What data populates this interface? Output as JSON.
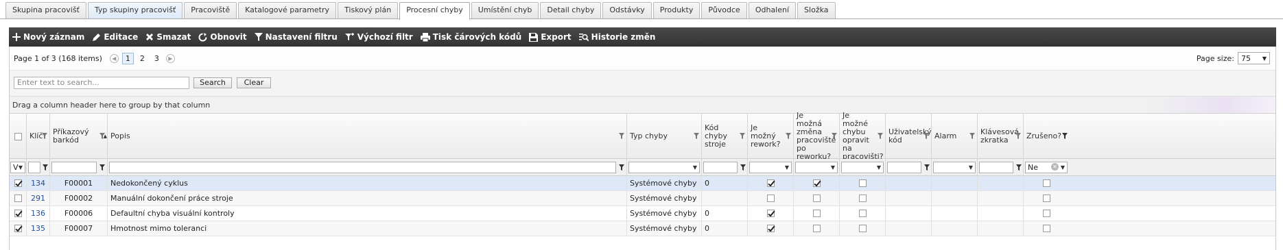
{
  "tabs": [
    {
      "label": "Skupina pracovišť",
      "state": "normal"
    },
    {
      "label": "Typ skupiny pracovišť",
      "state": "hover"
    },
    {
      "label": "Pracoviště",
      "state": "normal"
    },
    {
      "label": "Katalogové parametry",
      "state": "normal"
    },
    {
      "label": "Tiskový plán",
      "state": "normal"
    },
    {
      "label": "Procesní chyby",
      "state": "selected"
    },
    {
      "label": "Umístění chyb",
      "state": "normal"
    },
    {
      "label": "Detail chyby",
      "state": "normal"
    },
    {
      "label": "Odstávky",
      "state": "normal"
    },
    {
      "label": "Produkty",
      "state": "normal"
    },
    {
      "label": "Původce",
      "state": "normal"
    },
    {
      "label": "Odhalení",
      "state": "normal"
    },
    {
      "label": "Složka",
      "state": "normal"
    }
  ],
  "toolbar": {
    "new": "Nový záznam",
    "edit": "Editace",
    "delete": "Smazat",
    "refresh": "Obnovit",
    "filter_settings": "Nastavení filtru",
    "default_filter": "Výchozí filtr",
    "print_barcodes": "Tisk čárových kódů",
    "export": "Export",
    "history": "Historie změn"
  },
  "pager": {
    "info": "Page 1 of 3 (168 items)",
    "pages": [
      "1",
      "2",
      "3"
    ],
    "current_page": "1",
    "page_size_label": "Page size:",
    "page_size": "75"
  },
  "search": {
    "placeholder": "Enter text to search...",
    "search_button": "Search",
    "clear_button": "Clear"
  },
  "group_panel_text": "Drag a column header here to group by that column",
  "columns": {
    "key": "Klíč",
    "barcode": "Příkazový barkód",
    "description": "Popis",
    "error_type": "Typ chyby",
    "machine_code": "Kód chyby stroje",
    "rework": "Je možný rework?",
    "change_ws": "Je možná změna pracoviště po reworku?",
    "fix_ws": "Je možné chybu opravit na pracovišti?",
    "user_code": "Uživatelský kód",
    "alarm": "Alarm",
    "shortcut": "Klávesová zkratka",
    "cancelled": "Zrušeno?"
  },
  "filters": {
    "select_value": "V",
    "cancelled_value": "Ne"
  },
  "rows": [
    {
      "checked": true,
      "key": "134",
      "barcode": "F00001",
      "description": "Nedokončený cyklus",
      "error_type": "Systémové chyby",
      "machine_code": "0",
      "rework": true,
      "change_ws": true,
      "fix_ws": false,
      "cancelled": false
    },
    {
      "checked": false,
      "key": "291",
      "barcode": "F00002",
      "description": "Manuální dokončení práce stroje",
      "error_type": "Systémové chyby",
      "machine_code": "",
      "rework": false,
      "change_ws": false,
      "fix_ws": false,
      "cancelled": false
    },
    {
      "checked": true,
      "key": "136",
      "barcode": "F00006",
      "description": "Defaultní chyba visuální kontroly",
      "error_type": "Systémové chyby",
      "machine_code": "0",
      "rework": true,
      "change_ws": false,
      "fix_ws": false,
      "cancelled": false
    },
    {
      "checked": true,
      "key": "135",
      "barcode": "F00007",
      "description": "Hmotnost mimo toleranci",
      "error_type": "Systémové chyby",
      "machine_code": "0",
      "rework": true,
      "change_ws": false,
      "fix_ws": false,
      "cancelled": false
    }
  ],
  "colors": {
    "toolbar_bg": "#3a3a3a",
    "selected_row": "#dfe8f6",
    "link_blue": "#1f4e96"
  }
}
